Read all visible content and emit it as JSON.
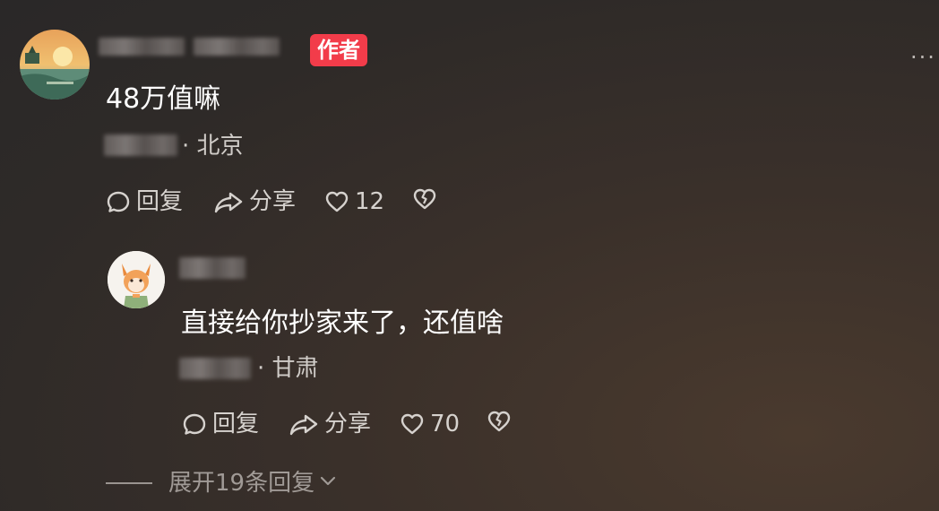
{
  "comment": {
    "author_badge": "作者",
    "text": "48万值嘛",
    "location": "· 北京",
    "reply_label": "回复",
    "share_label": "分享",
    "like_count": "12"
  },
  "reply": {
    "text": "直接给你抄家来了，还值啥",
    "location": "· 甘肃",
    "reply_label": "回复",
    "share_label": "分享",
    "like_count": "70"
  },
  "expand_replies_label": "展开19条回复",
  "more_label": "···",
  "icons": [
    "comment-bubble-icon",
    "share-arrow-icon",
    "heart-icon",
    "broken-heart-icon",
    "chevron-down-icon",
    "more-icon"
  ]
}
